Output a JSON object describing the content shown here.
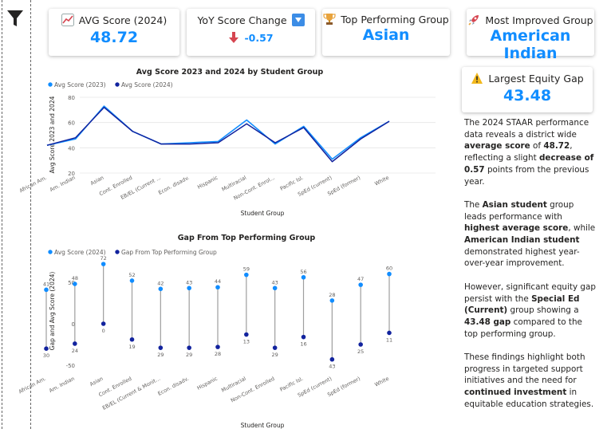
{
  "kpis": {
    "avg_score": {
      "title": "AVG Score (2024)",
      "value": "48.72",
      "icon": "chart-increasing-icon"
    },
    "yoy_change": {
      "title": "YoY Score Change",
      "value": "-0.57",
      "icon": "arrow-down-button-icon",
      "arrow_icon": "red-down-arrow-icon"
    },
    "top_group": {
      "title": "Top Performing Group",
      "value": "Asian",
      "icon": "trophy-icon"
    },
    "most_improved": {
      "title": "Most Improved Group",
      "value": "American Indian",
      "icon": "rocket-icon"
    },
    "equity_gap": {
      "title": "Largest Equity Gap",
      "value": "43.48",
      "icon": "warning-icon"
    }
  },
  "narrative": {
    "p1": [
      "The 2024 STAAR performance data reveals a district wide ",
      "average score",
      " of ",
      "48.72",
      ", reflecting a slight ",
      "decrease of 0.57",
      " points from the previous year."
    ],
    "p2": [
      "The ",
      "Asian student",
      " group leads performance with ",
      "highest average score",
      ", while ",
      "American Indian student",
      " demonstrated highest year-over-year improvement."
    ],
    "p3": [
      "However, significant equity gap persist with the ",
      "Special Ed (Current)",
      " group showing a ",
      "43.48 gap",
      " compared to the top performing group."
    ],
    "p4": [
      "These findings highlight both progress in targeted support initiatives and the need for ",
      "continued investment",
      " in equitable education strategies."
    ]
  },
  "colors": {
    "light_blue": "#118DFF",
    "dark_blue": "#12239E",
    "stem": "#9E9E9E",
    "red_arrow": "#D64550"
  },
  "chart_data": [
    {
      "type": "line",
      "title": "Avg Score 2023 and 2024 by Student Group",
      "xlabel": "Student Group",
      "ylabel": "Avg Score 2023 and 2024",
      "ylim": [
        20,
        80
      ],
      "yticks": [
        20,
        40,
        60,
        80
      ],
      "legend_position": "top-left",
      "categories": [
        "African Am.",
        "Am. Indian",
        "Asian",
        "Cont. Enrolled",
        "EB/EL (Current ...",
        "Econ. disadv.",
        "Hispanic",
        "Multiracial",
        "Non-Cont. Enrol...",
        "Pacific Isl.",
        "SpEd (current)",
        "SpEd (former)",
        "White"
      ],
      "series": [
        {
          "name": "Avg Score (2023)",
          "color": "#118DFF",
          "values": [
            42,
            47,
            73,
            53,
            43,
            44,
            45,
            62,
            43,
            57,
            31,
            48,
            61
          ]
        },
        {
          "name": "Avg Score (2024)",
          "color": "#12239E",
          "values": [
            42,
            48,
            72,
            53,
            43,
            43,
            44,
            59,
            44,
            56,
            29,
            47,
            61
          ]
        }
      ]
    },
    {
      "type": "scatter",
      "title": "Gap From Top Performing Group",
      "xlabel": "Student Group",
      "ylabel": "Gap and Avg Score (2024)",
      "ylim": [
        -50,
        75
      ],
      "yticks": [
        -50,
        0,
        50
      ],
      "legend_position": "top-left",
      "categories": [
        "African Am.",
        "Am. Indian",
        "Asian",
        "Cont. Enrolled",
        "EB/EL (Current & Monit...",
        "Econ. disadv.",
        "Hispanic",
        "Multiracial",
        "Non-Cont. Enrolled",
        "Pacific Isl.",
        "SpEd (current)",
        "SpEd (former)",
        "White"
      ],
      "series": [
        {
          "name": "Avg Score (2024)",
          "color": "#118DFF",
          "values": [
            41,
            48,
            72,
            52,
            42,
            43,
            44,
            59,
            43,
            56,
            28,
            47,
            60
          ],
          "labels": [
            "41",
            "48",
            "72",
            "52",
            "42",
            "43",
            "44",
            "59",
            "43",
            "56",
            "28",
            "47",
            "60"
          ]
        },
        {
          "name": "Gap From Top Performing Group",
          "color": "#12239E",
          "values": [
            -30,
            -24,
            0,
            -19,
            -29,
            -29,
            -28,
            -13,
            -29,
            -16,
            -43,
            -25,
            -11
          ],
          "labels": [
            "30",
            "24",
            "0",
            "19",
            "29",
            "29",
            "28",
            "13",
            "29",
            "16",
            "43",
            "25",
            "11"
          ]
        }
      ]
    }
  ]
}
